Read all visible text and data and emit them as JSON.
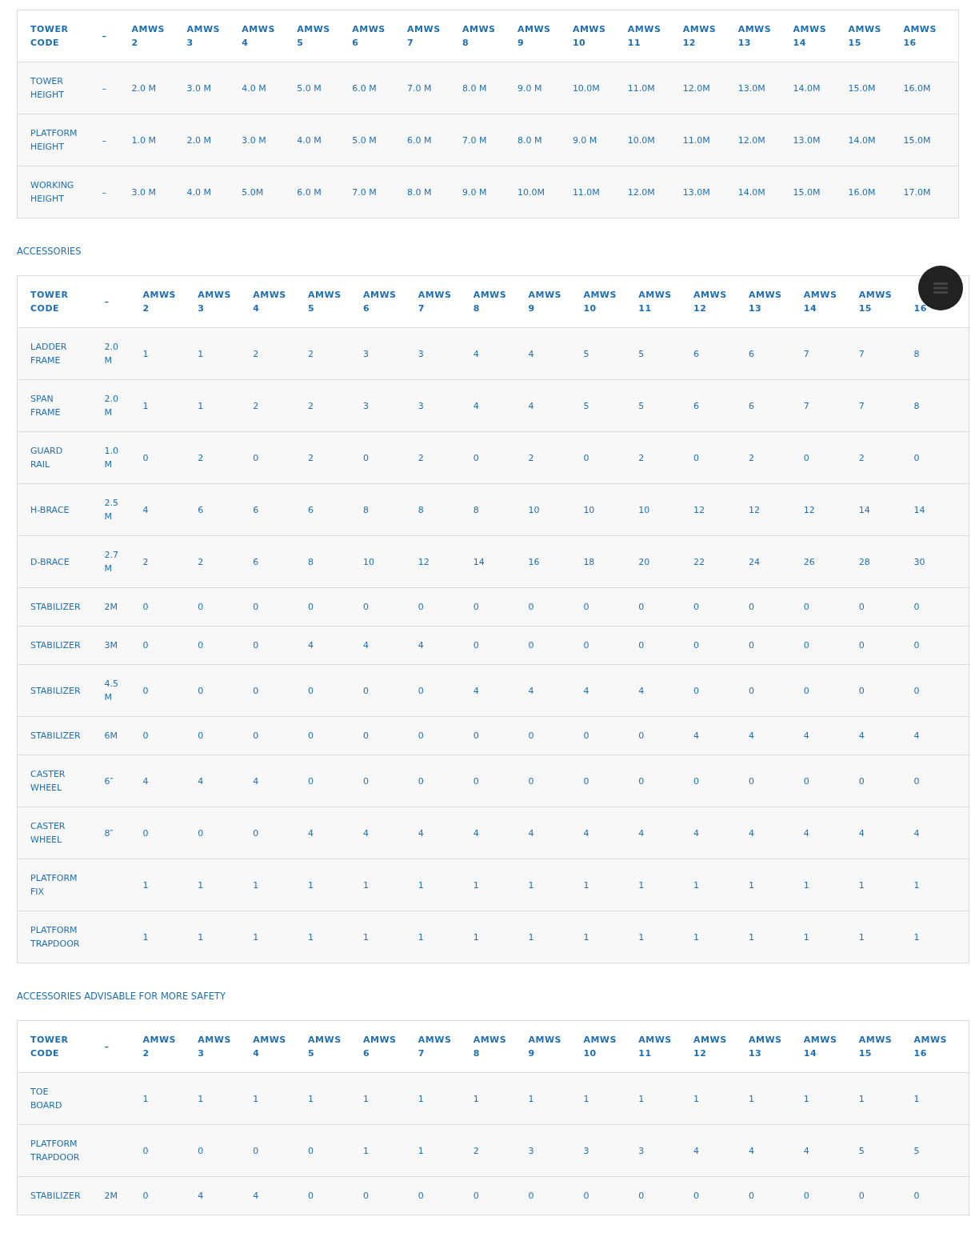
{
  "tables": [
    {
      "header": {
        "label": "TOWER CODE",
        "unit": "–",
        "columns": [
          {
            "line1": "AMWS",
            "line2": "2"
          },
          {
            "line1": "AMWS",
            "line2": "3"
          },
          {
            "line1": "AMWS",
            "line2": "4"
          },
          {
            "line1": "AMWS",
            "line2": "5"
          },
          {
            "line1": "AMWS",
            "line2": "6"
          },
          {
            "line1": "AMWS",
            "line2": "7"
          },
          {
            "line1": "AMWS",
            "line2": "8"
          },
          {
            "line1": "AMWS",
            "line2": "9"
          },
          {
            "line1": "AMWS",
            "line2": "10"
          },
          {
            "line1": "AMWS",
            "line2": "11"
          },
          {
            "line1": "AMWS",
            "line2": "12"
          },
          {
            "line1": "AMWS",
            "line2": "13"
          },
          {
            "line1": "AMWS",
            "line2": "14"
          },
          {
            "line1": "AMWS",
            "line2": "15"
          },
          {
            "line1": "AMWS",
            "line2": "16"
          }
        ]
      },
      "rows": [
        {
          "label": "TOWER HEIGHT",
          "unit": "–",
          "values": [
            "2.0 M",
            "3.0 M",
            "4.0 M",
            "5.0 M",
            "6.0 M",
            "7.0 M",
            "8.0 M",
            "9.0 M",
            "10.0M",
            "11.0M",
            "12.0M",
            "13.0M",
            "14.0M",
            "15.0M",
            "16.0M"
          ]
        },
        {
          "label": "PLATFORM HEIGHT",
          "unit": "–",
          "values": [
            "1.0 M",
            "2.0 M",
            "3.0 M",
            "4.0 M",
            "5.0 M",
            "6.0 M",
            "7.0 M",
            "8.0 M",
            "9.0 M",
            "10.0M",
            "11.0M",
            "12.0M",
            "13.0M",
            "14.0M",
            "15.0M"
          ]
        },
        {
          "label": "WORKING HEIGHT",
          "unit": "–",
          "values": [
            "3.0 M",
            "4.0 M",
            "5.0M",
            "6.0 M",
            "7.0 M",
            "8.0 M",
            "9.0 M",
            "10.0M",
            "11.0M",
            "12.0M",
            "13.0M",
            "14.0M",
            "15.0M",
            "16.0M",
            "17.0M"
          ]
        }
      ]
    },
    {
      "heading": "ACCESSORIES",
      "header": {
        "label": "TOWER CODE",
        "unit": "–",
        "columns": [
          {
            "line1": "AMWS",
            "line2": "2"
          },
          {
            "line1": "AMWS",
            "line2": "3"
          },
          {
            "line1": "AMWS",
            "line2": "4"
          },
          {
            "line1": "AMWS",
            "line2": "5"
          },
          {
            "line1": "AMWS",
            "line2": "6"
          },
          {
            "line1": "AMWS",
            "line2": "7"
          },
          {
            "line1": "AMWS",
            "line2": "8"
          },
          {
            "line1": "AMWS",
            "line2": "9"
          },
          {
            "line1": "AMWS",
            "line2": "10"
          },
          {
            "line1": "AMWS",
            "line2": "11"
          },
          {
            "line1": "AMWS",
            "line2": "12"
          },
          {
            "line1": "AMWS",
            "line2": "13"
          },
          {
            "line1": "AMWS",
            "line2": "14"
          },
          {
            "line1": "AMWS",
            "line2": "15"
          },
          {
            "line2": "16"
          }
        ]
      },
      "rows": [
        {
          "label": "LADDER FRAME",
          "unit": "2.0 M",
          "values": [
            "1",
            "1",
            "2",
            "2",
            "3",
            "3",
            "4",
            "4",
            "5",
            "5",
            "6",
            "6",
            "7",
            "7",
            "8"
          ]
        },
        {
          "label": "SPAN FRAME",
          "unit": "2.0 M",
          "values": [
            "1",
            "1",
            "2",
            "2",
            "3",
            "3",
            "4",
            "4",
            "5",
            "5",
            "6",
            "6",
            "7",
            "7",
            "8"
          ]
        },
        {
          "label": "GUARD RAIL",
          "unit": "1.0 M",
          "values": [
            "0",
            "2",
            "0",
            "2",
            "0",
            "2",
            "0",
            "2",
            "0",
            "2",
            "0",
            "2",
            "0",
            "2",
            "0"
          ]
        },
        {
          "label": "H-BRACE",
          "unit": "2.5 M",
          "values": [
            "4",
            "6",
            "6",
            "6",
            "8",
            "8",
            "8",
            "10",
            "10",
            "10",
            "12",
            "12",
            "12",
            "14",
            "14"
          ]
        },
        {
          "label": "D-BRACE",
          "unit": "2.7 M",
          "values": [
            "2",
            "2",
            "6",
            "8",
            "10",
            "12",
            "14",
            "16",
            "18",
            "20",
            "22",
            "24",
            "26",
            "28",
            "30"
          ]
        },
        {
          "label": "STABILIZER",
          "unit": "2M",
          "values": [
            "0",
            "0",
            "0",
            "0",
            "0",
            "0",
            "0",
            "0",
            "0",
            "0",
            "0",
            "0",
            "0",
            "0",
            "0"
          ]
        },
        {
          "label": "STABILIZER",
          "unit": "3M",
          "values": [
            "0",
            "0",
            "0",
            "4",
            "4",
            "4",
            "0",
            "0",
            "0",
            "0",
            "0",
            "0",
            "0",
            "0",
            "0"
          ]
        },
        {
          "label": "STABILIZER",
          "unit": "4.5 M",
          "values": [
            "0",
            "0",
            "0",
            "0",
            "0",
            "0",
            "4",
            "4",
            "4",
            "4",
            "0",
            "0",
            "0",
            "0",
            "0"
          ]
        },
        {
          "label": "STABILIZER",
          "unit": "6M",
          "values": [
            "0",
            "0",
            "0",
            "0",
            "0",
            "0",
            "0",
            "0",
            "0",
            "0",
            "4",
            "4",
            "4",
            "4",
            "4"
          ]
        },
        {
          "label": "CASTER WHEEL",
          "unit": "6″",
          "values": [
            "4",
            "4",
            "4",
            "0",
            "0",
            "0",
            "0",
            "0",
            "0",
            "0",
            "0",
            "0",
            "0",
            "0",
            "0"
          ]
        },
        {
          "label": "CASTER WHEEL",
          "unit": "8″",
          "values": [
            "0",
            "0",
            "0",
            "4",
            "4",
            "4",
            "4",
            "4",
            "4",
            "4",
            "4",
            "4",
            "4",
            "4",
            "4"
          ]
        },
        {
          "label": "PLATFORM FIX",
          "values": [
            "1",
            "1",
            "1",
            "1",
            "1",
            "1",
            "1",
            "1",
            "1",
            "1",
            "1",
            "1",
            "1",
            "1",
            "1"
          ]
        },
        {
          "label": "PLATFORM TRAPDOOR",
          "values": [
            "1",
            "1",
            "1",
            "1",
            "1",
            "1",
            "1",
            "1",
            "1",
            "1",
            "1",
            "1",
            "1",
            "1",
            "1"
          ]
        }
      ]
    },
    {
      "heading": "ACCESSORIES ADVISABLE FOR MORE SAFETY",
      "header": {
        "label": "TOWER CODE",
        "unit": "–",
        "columns": [
          {
            "line1": "AMWS",
            "line2": "2"
          },
          {
            "line1": "AMWS",
            "line2": "3"
          },
          {
            "line1": "AMWS",
            "line2": "4"
          },
          {
            "line1": "AMWS",
            "line2": "5"
          },
          {
            "line1": "AMWS",
            "line2": "6"
          },
          {
            "line1": "AMWS",
            "line2": "7"
          },
          {
            "line1": "AMWS",
            "line2": "8"
          },
          {
            "line1": "AMWS",
            "line2": "9"
          },
          {
            "line1": "AMWS",
            "line2": "10"
          },
          {
            "line1": "AMWS",
            "line2": "11"
          },
          {
            "line1": "AMWS",
            "line2": "12"
          },
          {
            "line1": "AMWS",
            "line2": "13"
          },
          {
            "line1": "AMWS",
            "line2": "14"
          },
          {
            "line1": "AMWS",
            "line2": "15"
          },
          {
            "line1": "AMWS",
            "line2": "16"
          }
        ]
      },
      "rows": [
        {
          "label": "TOE BOARD",
          "values": [
            "1",
            "1",
            "1",
            "1",
            "1",
            "1",
            "1",
            "1",
            "1",
            "1",
            "1",
            "1",
            "1",
            "1",
            "1"
          ]
        },
        {
          "label": "PLATFORM TRAPDOOR",
          "values": [
            "0",
            "0",
            "0",
            "0",
            "1",
            "1",
            "2",
            "3",
            "3",
            "3",
            "4",
            "4",
            "4",
            "5",
            "5"
          ]
        },
        {
          "label": "STABILIZER",
          "unit": "2M",
          "values": [
            "0",
            "4",
            "4",
            "0",
            "0",
            "0",
            "0",
            "0",
            "0",
            "0",
            "0",
            "0",
            "0",
            "0",
            "0"
          ]
        }
      ]
    }
  ],
  "menu_button": {
    "kind": "hamburger"
  }
}
